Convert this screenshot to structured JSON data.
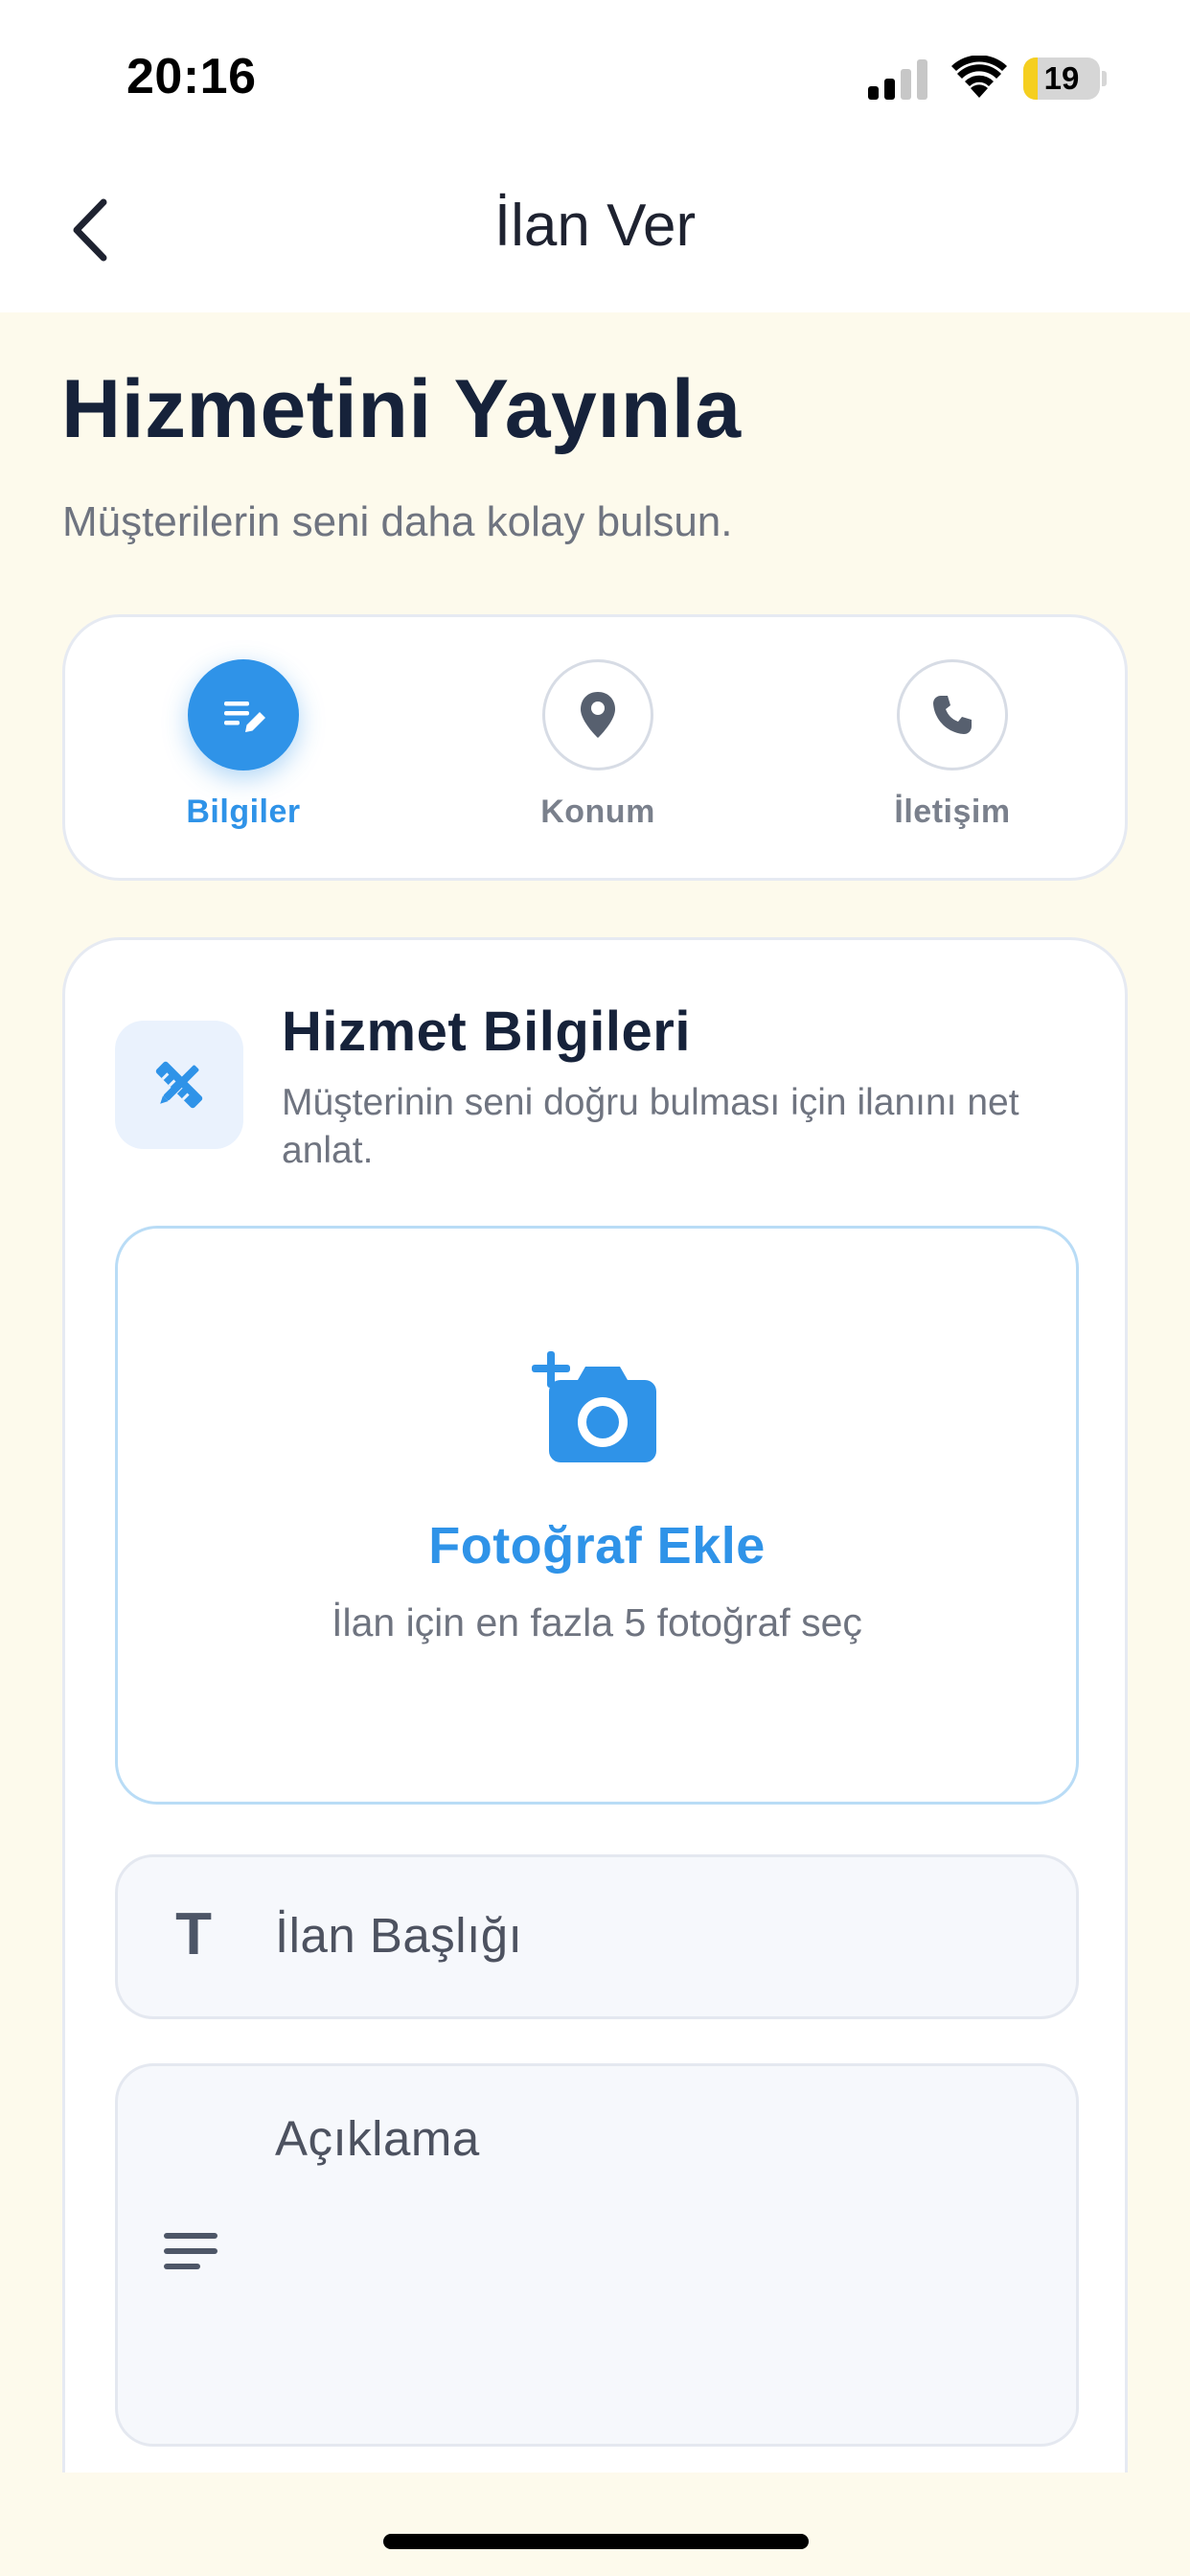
{
  "status_bar": {
    "time": "20:16",
    "battery_level": "19",
    "battery_fraction": 0.19,
    "icons": [
      "signal-icon",
      "wifi-icon",
      "battery-icon"
    ]
  },
  "nav": {
    "title": "İlan Ver",
    "back_icon": "chevron-left-icon"
  },
  "header": {
    "title": "Hizmetini Yayınla",
    "subtitle": "Müşterilerin seni daha kolay bulsun."
  },
  "steps": [
    {
      "label": "Bilgiler",
      "icon": "edit-note-icon",
      "active": true
    },
    {
      "label": "Konum",
      "icon": "location-pin-icon",
      "active": false
    },
    {
      "label": "İletişim",
      "icon": "phone-icon",
      "active": false
    }
  ],
  "form": {
    "section_icon": "tools-icon",
    "section_title": "Hizmet Bilgileri",
    "section_desc": "Müşterinin seni doğru bulması için ilanını net anlat.",
    "photo": {
      "icon": "add-camera-icon",
      "label": "Fotoğraf Ekle",
      "hint": "İlan için en fazla 5 fotoğraf seç"
    },
    "title_field": {
      "icon": "text-T-icon",
      "icon_glyph": "T",
      "placeholder": "İlan Başlığı"
    },
    "desc_field": {
      "icon": "lines-icon",
      "placeholder": "Açıklama"
    }
  },
  "colors": {
    "accent": "#2f93e8",
    "background": "#fdfaec",
    "title_text": "#16223a"
  }
}
